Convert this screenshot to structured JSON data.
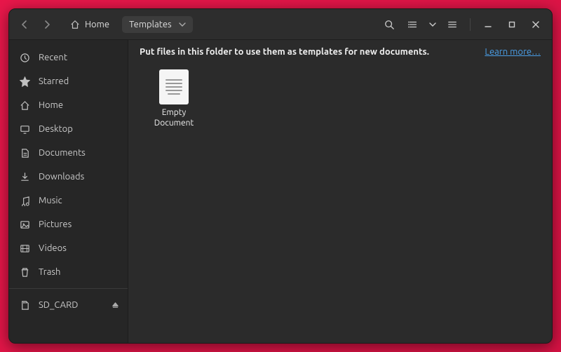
{
  "breadcrumb": {
    "home": "Home",
    "current": "Templates"
  },
  "sidebar": {
    "items": [
      {
        "label": "Recent",
        "icon": "clock"
      },
      {
        "label": "Starred",
        "icon": "star"
      },
      {
        "label": "Home",
        "icon": "home"
      },
      {
        "label": "Desktop",
        "icon": "desktop"
      },
      {
        "label": "Documents",
        "icon": "doc"
      },
      {
        "label": "Downloads",
        "icon": "download"
      },
      {
        "label": "Music",
        "icon": "music"
      },
      {
        "label": "Pictures",
        "icon": "image"
      },
      {
        "label": "Videos",
        "icon": "video"
      },
      {
        "label": "Trash",
        "icon": "trash"
      }
    ],
    "devices": [
      {
        "label": "SD_CARD",
        "icon": "sd",
        "ejectable": true
      }
    ]
  },
  "info": {
    "message": "Put files in this folder to use them as templates for new documents.",
    "link": "Learn more…"
  },
  "files": [
    {
      "label": "Empty Document"
    }
  ]
}
